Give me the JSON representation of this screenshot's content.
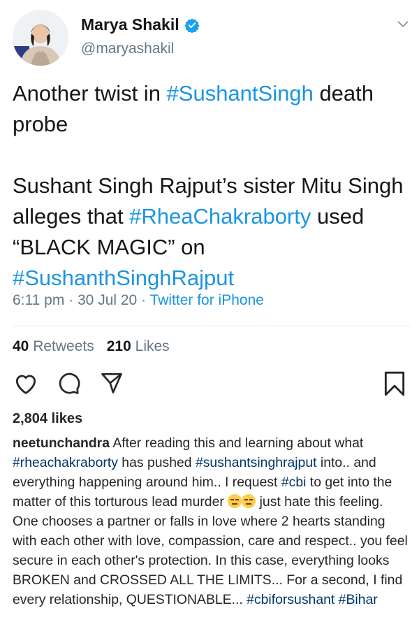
{
  "tweet": {
    "author_name": "Marya Shakil",
    "author_handle": "@maryashakil",
    "text_line1_pre": "Another twist in ",
    "text_line1_tag": "#SushantSingh",
    "text_line1_post": " death probe",
    "text2_pre": "Sushant Singh Rajput’s sister Mitu Singh alleges that ",
    "text2_tag1": "#RheaChakraborty",
    "text2_mid": " used “BLACK MAGIC” on ",
    "text2_tag2": "#SushanthSinghRajput",
    "time": "6:11 pm",
    "date": "30 Jul 20",
    "source": "Twitter for iPhone",
    "sep": " · ",
    "retweets_count": "40",
    "retweets_label": "Retweets",
    "likes_count": "210",
    "likes_label": "Likes"
  },
  "post": {
    "likes": "2,804 likes",
    "username": "neetunchandra",
    "c1": " After reading this and learning about what ",
    "t1": "#rheachakraborty",
    "c2": " has pushed ",
    "t2": "#sushantsinghrajput",
    "c3": " into.. and everything happening around him.. I request ",
    "t3": "#cbi",
    "c4": " to get into the matter of this torturous lead murder ",
    "c5": " just hate this feeling. One chooses a partner or falls in love where 2 hearts standing with each other with love, compassion, care and respect.. you feel secure in each other's protection. In this case, everything looks BROKEN and CROSSED ALL THE LIMITS... For a second, I find every relationship, QUESTIONABLE... ",
    "t4": "#cbiforsushant",
    "t5": "#Bihar"
  },
  "colors": {
    "link": "#1b95e0",
    "muted": "#657786",
    "ig_hashtag": "#003569"
  },
  "icons": [
    "verified-icon",
    "chevron-down-icon",
    "heart-icon",
    "comment-icon",
    "share-icon",
    "bookmark-icon"
  ]
}
